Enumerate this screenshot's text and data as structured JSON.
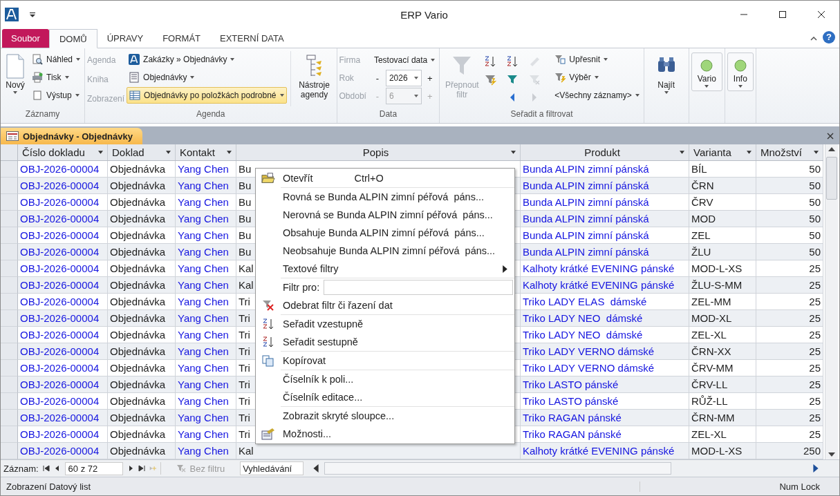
{
  "window": {
    "title": "ERP Vario"
  },
  "ribbon": {
    "tabs": [
      {
        "label": "Soubor",
        "kind": "file",
        "selected": false
      },
      {
        "label": "DOMŮ",
        "kind": "tab",
        "selected": true
      },
      {
        "label": "ÚPRAVY",
        "kind": "tab",
        "selected": false
      },
      {
        "label": "FORMÁT",
        "kind": "tab",
        "selected": false
      },
      {
        "label": "EXTERNÍ DATA",
        "kind": "tab",
        "selected": false
      }
    ],
    "help": "?",
    "records": {
      "title": "Záznamy",
      "new": "Nový",
      "items": [
        "Náhled",
        "Tisk",
        "Výstup"
      ]
    },
    "agenda": {
      "title": "Agenda",
      "labels": [
        "Agenda",
        "Kniha",
        "Zobrazení"
      ],
      "values": [
        {
          "text": "Zakázky » Objednávky",
          "selected": false
        },
        {
          "text": "Objednávky",
          "selected": false
        },
        {
          "text": "Objednávky po položkách podrobné",
          "selected": true
        }
      ],
      "tools": "Nástroje agendy"
    },
    "data": {
      "title": "Data",
      "company": {
        "label": "Firma",
        "value": "Testovací data"
      },
      "fields": [
        {
          "label": "Rok",
          "minus": "-",
          "value": "2026",
          "plus": "+",
          "disabled": false
        },
        {
          "label": "Období",
          "minus": "-",
          "value": "6",
          "plus": "+",
          "disabled": true
        }
      ]
    },
    "sort": {
      "title": "Seřadit a filtrovat",
      "toggle": {
        "label": "Přepnout filtr",
        "disabled": true
      },
      "tools": [
        {
          "kind": "sort-asc",
          "disabled": false
        },
        {
          "kind": "sort-desc",
          "disabled": false
        },
        {
          "kind": "clear-sort",
          "disabled": true
        },
        {
          "kind": "selection",
          "disabled": false
        },
        {
          "kind": "filter",
          "disabled": false
        },
        {
          "kind": "clear-filter",
          "disabled": true
        },
        {
          "kind": "prev",
          "disabled": false
        },
        {
          "kind": "next",
          "disabled": true
        }
      ],
      "advanced": "Upřesnit",
      "selection": "Výběr",
      "records": "<Všechny záznamy>"
    },
    "find": "Najít",
    "vario": "Vario",
    "info": "Info"
  },
  "document": {
    "title": "Objednávky - Objednávky"
  },
  "table": {
    "columns": [
      "Číslo dokladu",
      "Doklad",
      "Kontakt",
      "Popis",
      "Produkt",
      "Varianta",
      "Množství"
    ],
    "rows": [
      {
        "number": "OBJ-2026-00004",
        "doc": "Objednávka",
        "contact": "Yang Chen",
        "description": "Bu",
        "product": "Bunda ALPIN zimní pánská",
        "variant": "BÍL",
        "qty": "50"
      },
      {
        "number": "OBJ-2026-00004",
        "doc": "Objednávka",
        "contact": "Yang Chen",
        "description": "Bu",
        "product": "Bunda ALPIN zimní pánská",
        "variant": "ČRN",
        "qty": "50"
      },
      {
        "number": "OBJ-2026-00004",
        "doc": "Objednávka",
        "contact": "Yang Chen",
        "description": "Bu",
        "product": "Bunda ALPIN zimní pánská",
        "variant": "ČRV",
        "qty": "50"
      },
      {
        "number": "OBJ-2026-00004",
        "doc": "Objednávka",
        "contact": "Yang Chen",
        "description": "Bu",
        "product": "Bunda ALPIN zimní pánská",
        "variant": "MOD",
        "qty": "50"
      },
      {
        "number": "OBJ-2026-00004",
        "doc": "Objednávka",
        "contact": "Yang Chen",
        "description": "Bu",
        "product": "Bunda ALPIN zimní pánská",
        "variant": "ZEL",
        "qty": "50"
      },
      {
        "number": "OBJ-2026-00004",
        "doc": "Objednávka",
        "contact": "Yang Chen",
        "description": "Bu",
        "product": "Bunda ALPIN zimní pánská",
        "variant": "ŽLU",
        "qty": "50"
      },
      {
        "number": "OBJ-2026-00004",
        "doc": "Objednávka",
        "contact": "Yang Chen",
        "description": "Kal",
        "product": "Kalhoty krátké EVENING pánské",
        "variant": "MOD-L-XS",
        "qty": "25"
      },
      {
        "number": "OBJ-2026-00004",
        "doc": "Objednávka",
        "contact": "Yang Chen",
        "description": "Kal",
        "product": "Kalhoty krátké EVENING pánské",
        "variant": "ŽLU-S-MM",
        "qty": "25"
      },
      {
        "number": "OBJ-2026-00004",
        "doc": "Objednávka",
        "contact": "Yang Chen",
        "description": "Tri",
        "product": "Triko LADY ELAS  dámské",
        "variant": "ZEL-MM",
        "qty": "25"
      },
      {
        "number": "OBJ-2026-00004",
        "doc": "Objednávka",
        "contact": "Yang Chen",
        "description": "Tri",
        "product": "Triko LADY NEO  dámské",
        "variant": "MOD-XL",
        "qty": "25"
      },
      {
        "number": "OBJ-2026-00004",
        "doc": "Objednávka",
        "contact": "Yang Chen",
        "description": "Tri",
        "product": "Triko LADY NEO  dámské",
        "variant": "ZEL-XL",
        "qty": "25"
      },
      {
        "number": "OBJ-2026-00004",
        "doc": "Objednávka",
        "contact": "Yang Chen",
        "description": "Tri",
        "product": "Triko LADY VERNO dámské",
        "variant": "ČRN-XX",
        "qty": "25"
      },
      {
        "number": "OBJ-2026-00004",
        "doc": "Objednávka",
        "contact": "Yang Chen",
        "description": "Tri",
        "product": "Triko LADY VERNO dámské",
        "variant": "ČRV-MM",
        "qty": "25"
      },
      {
        "number": "OBJ-2026-00004",
        "doc": "Objednávka",
        "contact": "Yang Chen",
        "description": "Tri",
        "product": "Triko LASTO pánské",
        "variant": "ČRV-LL",
        "qty": "25"
      },
      {
        "number": "OBJ-2026-00004",
        "doc": "Objednávka",
        "contact": "Yang Chen",
        "description": "Tri",
        "product": "Triko LASTO pánské",
        "variant": "RŮŽ-LL",
        "qty": "25"
      },
      {
        "number": "OBJ-2026-00004",
        "doc": "Objednávka",
        "contact": "Yang Chen",
        "description": "Tri",
        "product": "Triko RAGAN pánské",
        "variant": "ČRN-MM",
        "qty": "25"
      },
      {
        "number": "OBJ-2026-00004",
        "doc": "Objednávka",
        "contact": "Yang Chen",
        "description": "Tri",
        "product": "Triko RAGAN pánské",
        "variant": "ZEL-XL",
        "qty": "25"
      },
      {
        "number": "OBJ-2026-00004",
        "doc": "Objednávka",
        "contact": "Yang Chen",
        "description": "Kal",
        "product": "Kalhoty krátké EVENING pánské",
        "variant": "MOD-L-XS",
        "qty": "250"
      }
    ]
  },
  "context_menu": {
    "items": [
      {
        "kind": "open",
        "label": "Otevřít",
        "shortcut": "Ctrl+O",
        "divider_above": false
      },
      {
        "kind": "plain",
        "label": "Rovná se Bunda ALPIN zimní péřová  páns...",
        "divider_above": true
      },
      {
        "kind": "plain",
        "label": "Nerovná se Bunda ALPIN zimní péřová  páns...",
        "divider_above": false
      },
      {
        "kind": "plain",
        "label": "Obsahuje Bunda ALPIN zimní péřová  páns...",
        "divider_above": false
      },
      {
        "kind": "plain",
        "label": "Neobsahuje Bunda ALPIN zimní péřová  páns...",
        "divider_above": false
      },
      {
        "kind": "submenu",
        "label": "Textové filtry",
        "divider_above": false
      },
      {
        "kind": "field",
        "label": "Filtr pro:",
        "divider_above": true
      },
      {
        "kind": "clear-filter",
        "label": "Odebrat filtr či řazení dat",
        "divider_above": false
      },
      {
        "kind": "sort-asc",
        "label": "Seřadit vzestupně",
        "divider_above": true
      },
      {
        "kind": "sort-desc",
        "label": "Seřadit sestupně",
        "divider_above": false
      },
      {
        "kind": "copy",
        "label": "Kopírovat",
        "divider_above": true
      },
      {
        "kind": "plain",
        "label": "Číselník k poli...",
        "divider_above": true
      },
      {
        "kind": "plain",
        "label": "Číselník editace...",
        "divider_above": false
      },
      {
        "kind": "plain",
        "label": "Zobrazit skryté sloupce...",
        "divider_above": true
      },
      {
        "kind": "options",
        "label": "Možnosti...",
        "divider_above": false
      }
    ]
  },
  "navigator": {
    "label": "Záznam:",
    "position": "60 z 72",
    "filter": "Bez filtru",
    "search_placeholder": "Vyhledávání"
  },
  "status_bar": {
    "view": "Zobrazení Datový list",
    "num_lock": "Num Lock"
  }
}
